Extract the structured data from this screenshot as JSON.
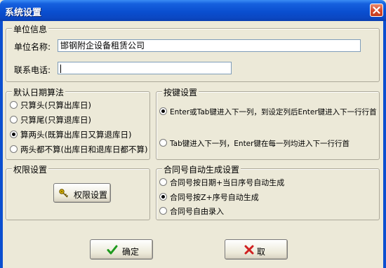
{
  "window": {
    "title": "系统设置"
  },
  "unit_info": {
    "legend": "单位信息",
    "name_label": "单位名称:",
    "name_value": "邯钢附企设备租赁公司",
    "phone_label": "联系电话:",
    "phone_value": ""
  },
  "date_calc": {
    "legend": "默认日期算法",
    "options": [
      {
        "label": "只算头(只算出库日)",
        "selected": false
      },
      {
        "label": "只算尾(只算退库日)",
        "selected": false
      },
      {
        "label": "算两头(既算出库日又算退库日)",
        "selected": true
      },
      {
        "label": "两头都不算(出库日和退库日都不算)",
        "selected": false
      }
    ]
  },
  "key_settings": {
    "legend": "按键设置",
    "options": [
      {
        "label": "Enter或Tab键进入下一列，到设定列后Enter键进入下一行行首",
        "selected": true
      },
      {
        "label": "Tab键进入下一列，Enter键在每一列均进入下一行行首",
        "selected": false
      }
    ]
  },
  "permissions": {
    "legend": "权限设置",
    "button_label": "权限设置"
  },
  "contract_no": {
    "legend": "合同号自动生成设置",
    "options": [
      {
        "label": "合同号按日期+当日序号自动生成",
        "selected": false
      },
      {
        "label": "合同号按Z+序号自动生成",
        "selected": true
      },
      {
        "label": "合同号自由录入",
        "selected": false
      }
    ]
  },
  "footer": {
    "ok_label": "确定",
    "cancel_label": "取"
  }
}
